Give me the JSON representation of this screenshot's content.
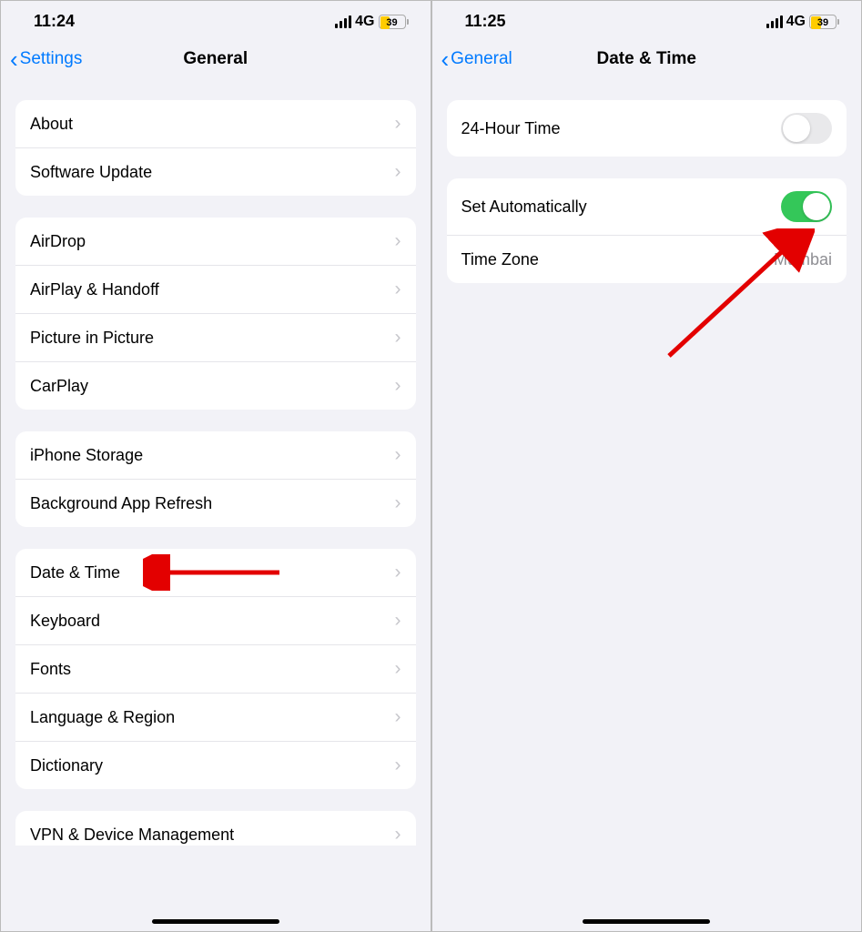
{
  "left": {
    "status": {
      "time": "11:24",
      "network": "4G",
      "battery": "39"
    },
    "nav": {
      "back": "Settings",
      "title": "General"
    },
    "groups": [
      {
        "items": [
          {
            "label": "About"
          },
          {
            "label": "Software Update"
          }
        ]
      },
      {
        "items": [
          {
            "label": "AirDrop"
          },
          {
            "label": "AirPlay & Handoff"
          },
          {
            "label": "Picture in Picture"
          },
          {
            "label": "CarPlay"
          }
        ]
      },
      {
        "items": [
          {
            "label": "iPhone Storage"
          },
          {
            "label": "Background App Refresh"
          }
        ]
      },
      {
        "items": [
          {
            "label": "Date & Time"
          },
          {
            "label": "Keyboard"
          },
          {
            "label": "Fonts"
          },
          {
            "label": "Language & Region"
          },
          {
            "label": "Dictionary"
          }
        ]
      }
    ],
    "cutoff": "VPN & Device Management"
  },
  "right": {
    "status": {
      "time": "11:25",
      "network": "4G",
      "battery": "39"
    },
    "nav": {
      "back": "General",
      "title": "Date & Time"
    },
    "row24h": "24-Hour Time",
    "rowSetAuto": "Set Automatically",
    "rowTimezone": {
      "label": "Time Zone",
      "value": "Mumbai"
    }
  }
}
